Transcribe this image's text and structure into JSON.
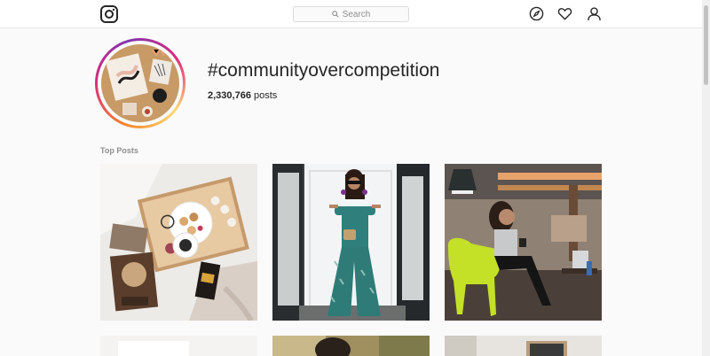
{
  "header": {
    "logo_icon": "instagram-logo-icon",
    "search": {
      "placeholder": "Search",
      "icon": "search-icon"
    },
    "nav_icons": [
      "compass-icon",
      "heart-icon",
      "user-icon"
    ]
  },
  "hashtag": {
    "title": "#communityovercompetition",
    "post_count": "2,330,766",
    "post_count_label": "posts"
  },
  "sections": {
    "top_posts_label": "Top Posts"
  },
  "posts": [
    {
      "name": "flatlay-breakfast-tray-post"
    },
    {
      "name": "woman-green-jumpsuit-door-post"
    },
    {
      "name": "woman-yellow-chair-cafe-post"
    },
    {
      "name": "post-4"
    },
    {
      "name": "post-5"
    },
    {
      "name": "post-6"
    }
  ],
  "colors": {
    "ring_gradient": [
      "#f58529",
      "#dd2a7b",
      "#8134af"
    ],
    "text": "#262626",
    "muted": "#8e8e8e"
  }
}
